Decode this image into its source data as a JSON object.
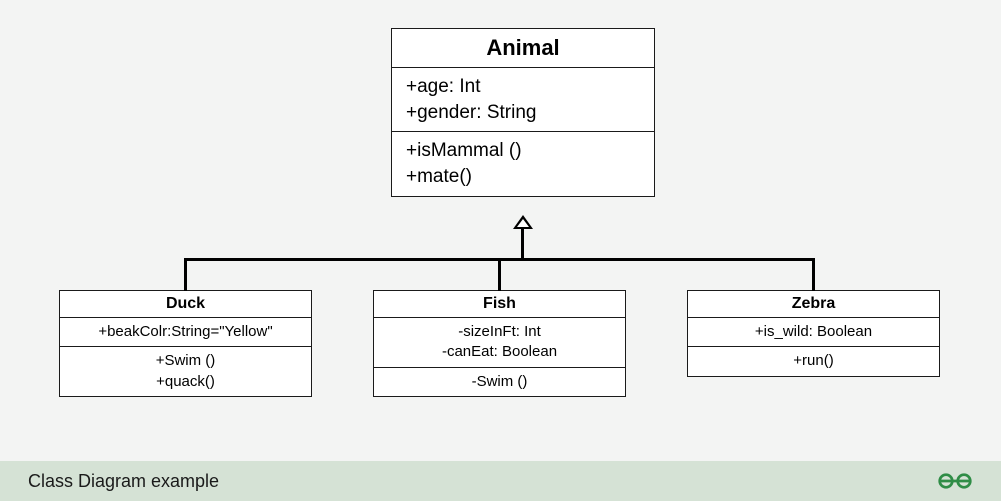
{
  "caption": "Class Diagram example",
  "logo_name": "geeksforgeeks-logo",
  "classes": {
    "animal": {
      "name": "Animal",
      "attributes": [
        "+age: Int",
        "+gender: String"
      ],
      "methods": [
        "+isMammal ()",
        "+mate()"
      ]
    },
    "duck": {
      "name": "Duck",
      "attributes": [
        "+beakColr:String=\"Yellow\""
      ],
      "methods": [
        "+Swim ()",
        "+quack()"
      ]
    },
    "fish": {
      "name": "Fish",
      "attributes": [
        "-sizeInFt: Int",
        "-canEat: Boolean"
      ],
      "methods": [
        "-Swim ()"
      ]
    },
    "zebra": {
      "name": "Zebra",
      "attributes": [
        "+is_wild: Boolean"
      ],
      "methods": [
        "+run()"
      ]
    }
  },
  "relationships": [
    {
      "type": "generalization",
      "parent": "animal",
      "child": "duck"
    },
    {
      "type": "generalization",
      "parent": "animal",
      "child": "fish"
    },
    {
      "type": "generalization",
      "parent": "animal",
      "child": "zebra"
    }
  ]
}
